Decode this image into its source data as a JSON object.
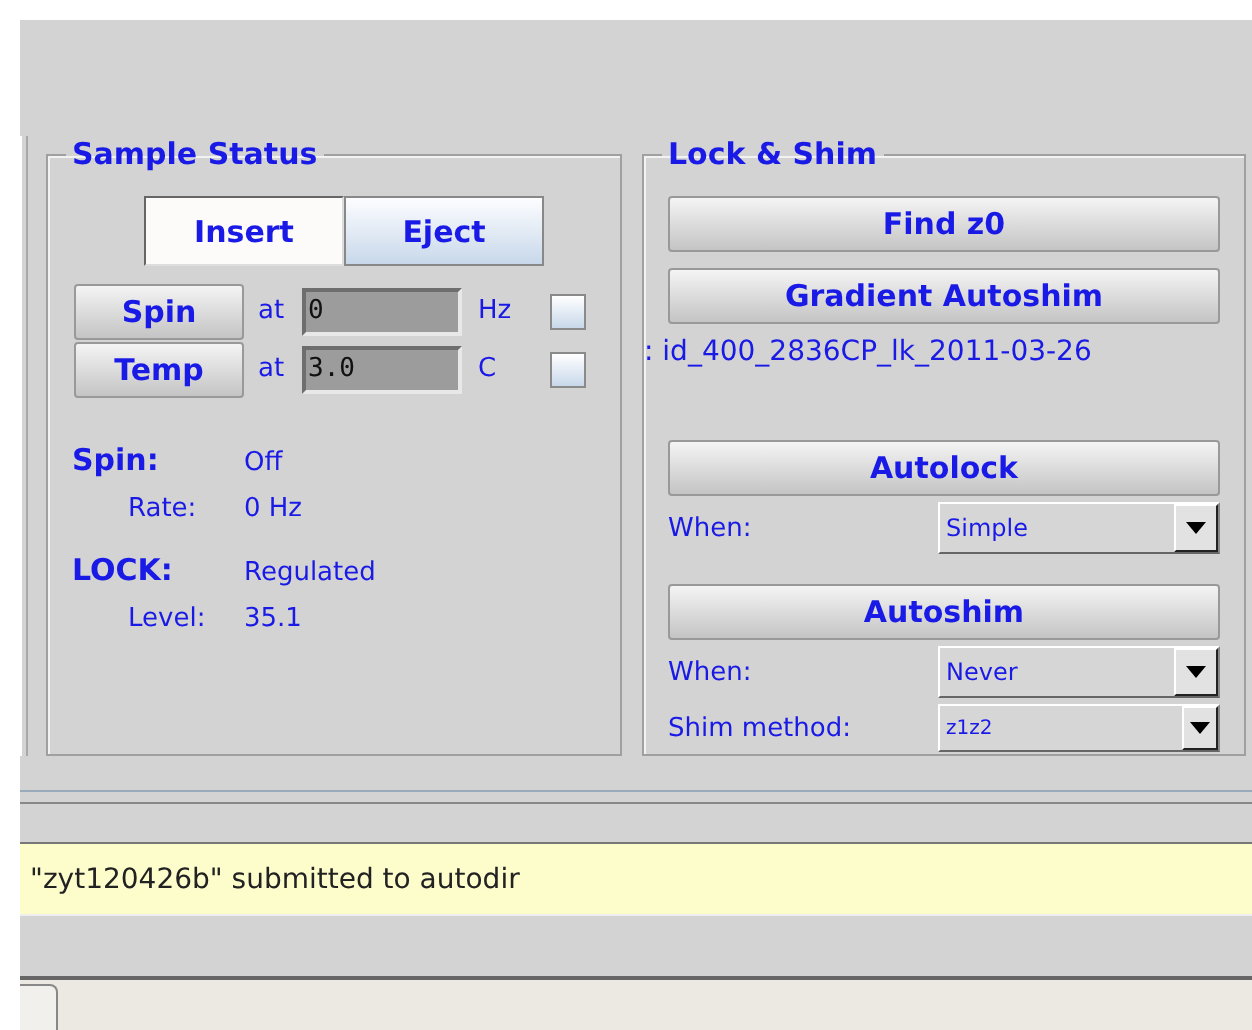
{
  "sample_status": {
    "title": "Sample Status",
    "toggle": [
      {
        "label": "Insert",
        "selected": true
      },
      {
        "label": "Eject",
        "selected": false
      }
    ],
    "controls": [
      {
        "button": "Spin",
        "at": "at",
        "value": "0",
        "unit": "Hz",
        "checked": false
      },
      {
        "button": "Temp",
        "at": "at",
        "value": "3.0",
        "unit": "C",
        "checked": false
      }
    ],
    "status": [
      {
        "kind": "heading",
        "label": "Spin:",
        "value": "Off"
      },
      {
        "kind": "sub",
        "label": "Rate:",
        "value": "0 Hz"
      },
      {
        "kind": "heading",
        "label": "LOCK:",
        "value": "Regulated"
      },
      {
        "kind": "sub",
        "label": "Level:",
        "value": "35.1"
      }
    ]
  },
  "lock_shim": {
    "title": "Lock & Shim",
    "buttons": [
      "Find z0",
      "Gradient Autoshim"
    ],
    "shim_file": ": id_400_2836CP_lk_2011-03-26",
    "groups": [
      {
        "button": "Autolock",
        "fields": [
          {
            "label": "When:",
            "value": "Simple",
            "compact": false
          }
        ]
      },
      {
        "button": "Autoshim",
        "fields": [
          {
            "label": "When:",
            "value": "Never",
            "compact": false
          },
          {
            "label": "Shim method:",
            "value": "z1z2",
            "compact": true
          }
        ]
      }
    ]
  },
  "status_message": "\"zyt120426b\" submitted to autodir"
}
